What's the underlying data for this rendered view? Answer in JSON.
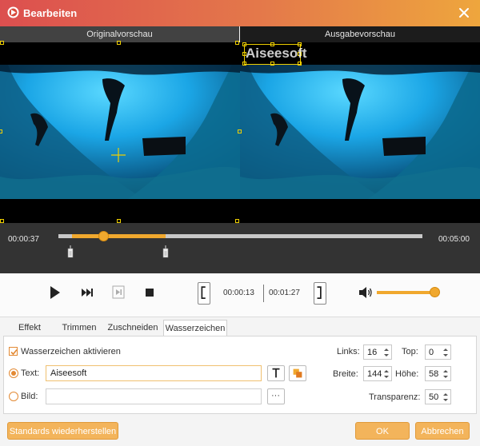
{
  "window": {
    "title": "Bearbeiten"
  },
  "preview": {
    "original_label": "Originalvorschau",
    "output_label": "Ausgabevorschau",
    "watermark_overlay_text": "Aiseesoft"
  },
  "timeline": {
    "current_time": "00:00:37",
    "total_time": "00:05:00",
    "position_fraction": 0.123
  },
  "playback": {
    "clip_start": "00:00:13",
    "clip_duration": "00:01:27",
    "volume_fraction": 1.0
  },
  "tabs": [
    {
      "label": "Effekt"
    },
    {
      "label": "Trimmen"
    },
    {
      "label": "Zuschneiden"
    },
    {
      "label": "Wasserzeichen",
      "active": true
    }
  ],
  "watermark": {
    "enable_label": "Wasserzeichen aktivieren",
    "enabled": true,
    "text_label": "Text:",
    "text_value": "Aiseesoft",
    "image_label": "Bild:",
    "image_value": "",
    "browse_label": "···",
    "mode": "text",
    "links_label": "Links:",
    "links_value": "16",
    "top_label": "Top:",
    "top_value": "0",
    "breite_label": "Breite:",
    "breite_value": "144",
    "hoehe_label": "Höhe:",
    "hoehe_value": "58",
    "transparenz_label": "Transparenz:",
    "transparenz_value": "50"
  },
  "footer": {
    "reset_label": "Standards wiederherstellen",
    "ok_label": "OK",
    "cancel_label": "Abbrechen"
  },
  "colors": {
    "accent": "#f0a82e",
    "title_gradient_start": "#dc4f4f",
    "title_gradient_end": "#eea63d",
    "button_orange": "#f3b45b"
  }
}
